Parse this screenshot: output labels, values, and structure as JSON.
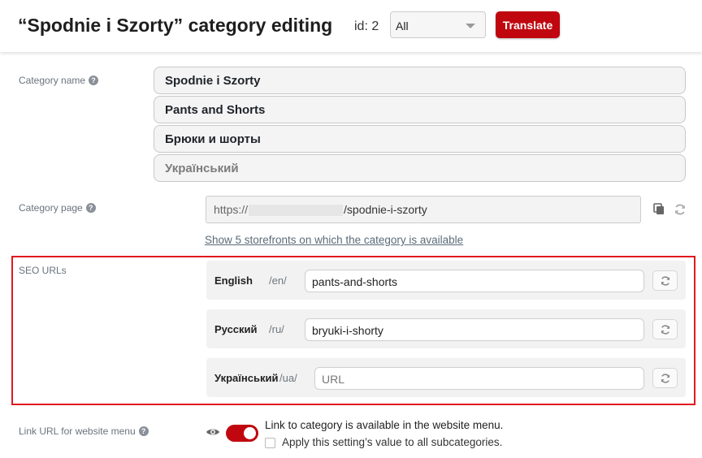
{
  "header": {
    "title": "“Spodnie i Szorty” category editing",
    "id_label": "id: 2",
    "language_select": {
      "selected": "All"
    },
    "translate_label": "Translate"
  },
  "category_name": {
    "label": "Category name",
    "values": [
      "Spodnie i Szorty",
      "Pants and Shorts",
      "Брюки и шорты"
    ],
    "placeholder": "Український"
  },
  "category_page": {
    "label": "Category page",
    "url_prefix": "https://",
    "url_slug": "/spodnie-i-szorty",
    "storefronts_link": "Show 5 storefronts on which the category is available"
  },
  "seo_urls": {
    "label": "SEO URLs",
    "rows": [
      {
        "language": "English",
        "prefix": "/en/",
        "value": "pants-and-shorts",
        "placeholder": ""
      },
      {
        "language": "Русский",
        "prefix": "/ru/",
        "value": "bryuki-i-shorty",
        "placeholder": ""
      },
      {
        "language": "Український",
        "prefix": "/ua/",
        "value": "",
        "placeholder": "URL"
      }
    ]
  },
  "menu_link": {
    "label": "Link URL for website menu",
    "toggle_on": true,
    "status_text": "Link to category is available in the website menu.",
    "apply_subcategories_text": "Apply this setting’s value to all subcategories.",
    "apply_subcategories_checked": false
  },
  "colors": {
    "accent": "#c0070f",
    "highlight_border": "#e0191f"
  }
}
